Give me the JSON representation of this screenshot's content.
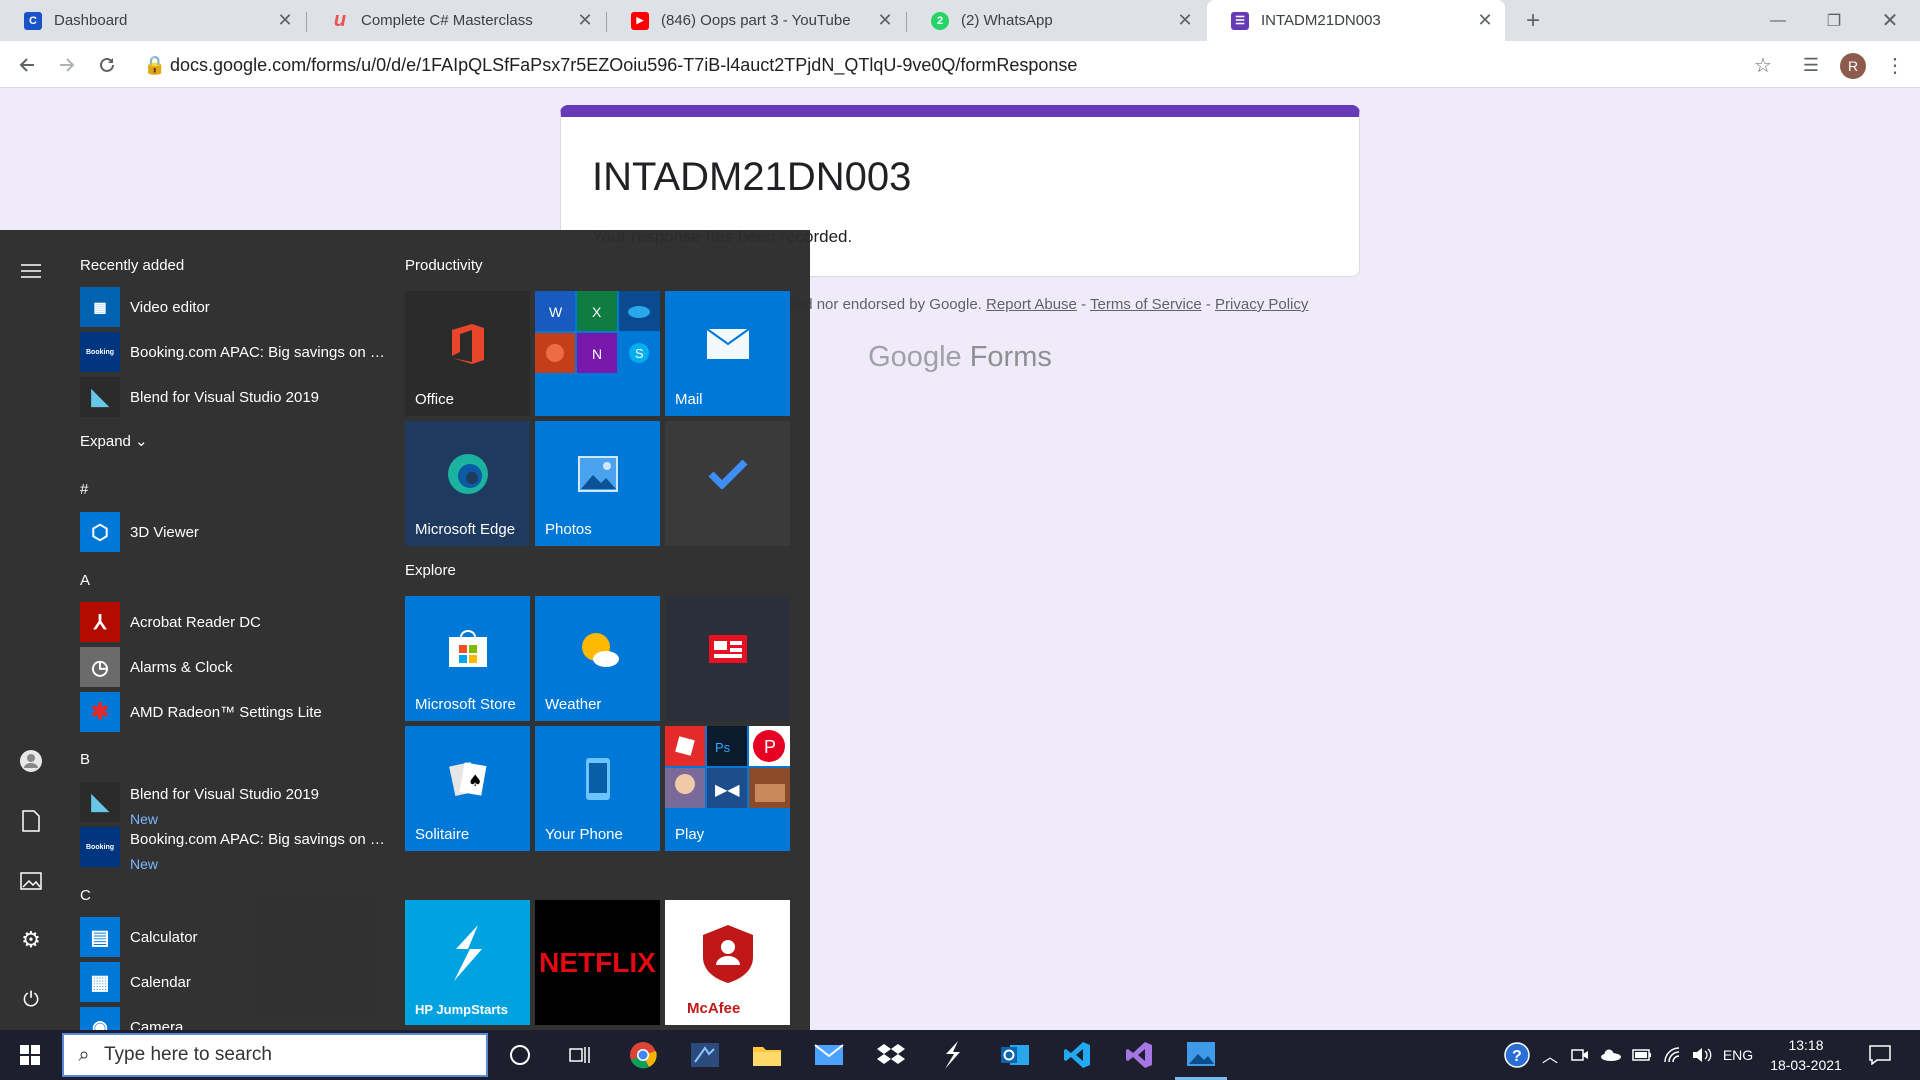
{
  "browser": {
    "tabs": [
      {
        "title": "Dashboard",
        "icon": "coursera-icon",
        "color": "#1a53c7",
        "glyph": "C"
      },
      {
        "title": "Complete C# Masterclass",
        "icon": "udemy-icon",
        "color": "#ec5252",
        "glyph": "u"
      },
      {
        "title": "(846) Oops part 3 - YouTube",
        "icon": "youtube-icon",
        "color": "#ff0000",
        "glyph": "▶"
      },
      {
        "title": "(2) WhatsApp",
        "icon": "whatsapp-icon",
        "color": "#25d366",
        "glyph": "2"
      },
      {
        "title": "INTADM21DN003",
        "icon": "google-forms-icon",
        "color": "#673ab7",
        "glyph": "☰"
      }
    ],
    "url": "docs.google.com/forms/u/0/d/e/1FAIpQLSfFaPsx7r5EZOoiu596-T7iB-l4auct2TPjdN_QTlqU-9ve0Q/formResponse",
    "avatar_letter": "R"
  },
  "form": {
    "title": "INTADM21DN003",
    "message": "Your response has been recorded.",
    "footer_text": "This content is neither created nor endorsed by Google.",
    "report_abuse": "Report Abuse",
    "terms": "Terms of Service",
    "privacy": "Privacy Policy",
    "sep": "-",
    "logo_google": "Google",
    "logo_forms": "Forms"
  },
  "start_menu": {
    "recently_added_header": "Recently added",
    "expand_label": "Expand",
    "recent": [
      {
        "name": "Video editor",
        "icon": "video-editor-icon",
        "color": "#0063b1"
      },
      {
        "name": "Booking.com APAC: Big savings on h...",
        "icon": "booking-icon",
        "color": "#003580"
      },
      {
        "name": "Blend for Visual Studio 2019",
        "icon": "blend-icon",
        "color": "#2b2b2b"
      }
    ],
    "sections": [
      {
        "letter": "#",
        "apps": [
          {
            "name": "3D Viewer",
            "icon": "3d-viewer-icon",
            "color": "#0078d7",
            "new": ""
          }
        ]
      },
      {
        "letter": "A",
        "apps": [
          {
            "name": "Acrobat Reader DC",
            "icon": "acrobat-icon",
            "color": "#b30b00",
            "new": ""
          },
          {
            "name": "Alarms & Clock",
            "icon": "alarms-clock-icon",
            "color": "#0078d7",
            "new": ""
          },
          {
            "name": "AMD Radeon™ Settings Lite",
            "icon": "amd-radeon-icon",
            "color": "#0078d7",
            "new": ""
          }
        ]
      },
      {
        "letter": "B",
        "apps": [
          {
            "name": "Blend for Visual Studio 2019",
            "icon": "blend-icon",
            "color": "#2b2b2b",
            "new": "New"
          },
          {
            "name": "Booking.com APAC: Big savings on h...",
            "icon": "booking-icon",
            "color": "#003580",
            "new": "New"
          }
        ]
      },
      {
        "letter": "C",
        "apps": [
          {
            "name": "Calculator",
            "icon": "calculator-icon",
            "color": "#0078d7",
            "new": ""
          },
          {
            "name": "Calendar",
            "icon": "calendar-icon",
            "color": "#0078d7",
            "new": ""
          },
          {
            "name": "Camera",
            "icon": "camera-icon",
            "color": "#0078d7",
            "new": ""
          }
        ]
      }
    ],
    "groups": [
      "Productivity",
      "Explore"
    ],
    "tiles": [
      {
        "label": "Office",
        "icon": "office-icon",
        "bg": "#2b2b2b"
      },
      {
        "label": "",
        "icon": "office-apps-icon",
        "bg": "#0078d7"
      },
      {
        "label": "Mail",
        "icon": "mail-icon",
        "bg": "#0078d7"
      },
      {
        "label": "Microsoft Edge",
        "icon": "edge-icon",
        "bg": "#1e3a5f"
      },
      {
        "label": "Photos",
        "icon": "photos-icon",
        "bg": "#0078d7"
      },
      {
        "label": "",
        "icon": "todo-icon",
        "bg": "#3a3a3a"
      },
      {
        "label": "Microsoft Store",
        "icon": "store-icon",
        "bg": "#0078d7"
      },
      {
        "label": "Weather",
        "icon": "weather-icon",
        "bg": "#0078d7"
      },
      {
        "label": "",
        "icon": "news-icon",
        "bg": "#2b2f3a"
      },
      {
        "label": "Solitaire",
        "icon": "solitaire-icon",
        "bg": "#0078d7"
      },
      {
        "label": "Your Phone",
        "icon": "your-phone-icon",
        "bg": "#0078d7"
      },
      {
        "label": "Play",
        "icon": "play-folder-icon",
        "bg": "#0078d7"
      },
      {
        "label": "HP JumpStarts",
        "icon": "hp-jumpstarts-icon",
        "bg": "#00a3e0"
      },
      {
        "label": "NETFLIX",
        "icon": "netflix-icon",
        "bg": "#000000"
      },
      {
        "label": "McAfee",
        "icon": "mcafee-icon",
        "bg": "#ffffff"
      }
    ]
  },
  "taskbar": {
    "search_placeholder": "Type here to search",
    "lang": "ENG",
    "time": "13:18",
    "date": "18-03-2021"
  }
}
